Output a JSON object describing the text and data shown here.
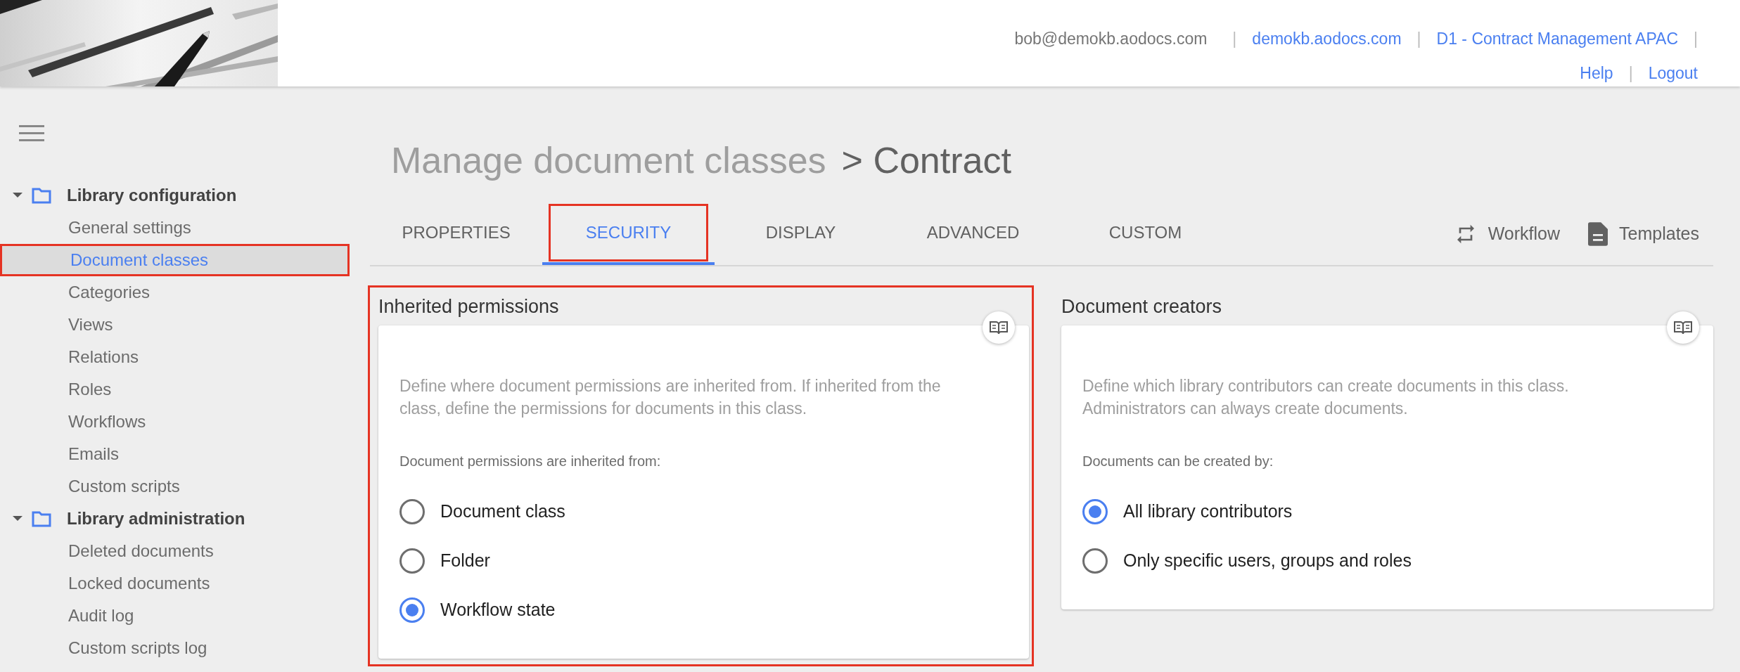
{
  "header": {
    "banner": {
      "kind": "picture"
    },
    "user_email": "bob@demokb.aodocs.com",
    "links": [
      {
        "label": "demokb.aodocs.com"
      },
      {
        "label": "D1 - Contract Management APAC"
      },
      {
        "label": "Help"
      },
      {
        "label": "Logout"
      }
    ],
    "separators": [
      "|",
      "|",
      "|",
      "|"
    ]
  },
  "sidebar": {
    "groups": [
      {
        "label": "Library configuration",
        "expanded": true,
        "children": [
          {
            "label": "General settings",
            "selected": false,
            "highlighted": false
          },
          {
            "label": "Document classes",
            "selected": true,
            "highlighted": true
          },
          {
            "label": "Categories",
            "selected": false,
            "highlighted": false
          },
          {
            "label": "Views",
            "selected": false,
            "highlighted": false
          },
          {
            "label": "Relations",
            "selected": false,
            "highlighted": false
          },
          {
            "label": "Roles",
            "selected": false,
            "highlighted": false
          },
          {
            "label": "Workflows",
            "selected": false,
            "highlighted": false
          },
          {
            "label": "Emails",
            "selected": false,
            "highlighted": false
          },
          {
            "label": "Custom scripts",
            "selected": false,
            "highlighted": false
          }
        ]
      },
      {
        "label": "Library administration",
        "expanded": true,
        "children": [
          {
            "label": "Deleted documents",
            "selected": false,
            "highlighted": false
          },
          {
            "label": "Locked documents",
            "selected": false,
            "highlighted": false
          },
          {
            "label": "Audit log",
            "selected": false,
            "highlighted": false
          },
          {
            "label": "Custom scripts log",
            "selected": false,
            "highlighted": false
          }
        ]
      }
    ]
  },
  "page_title": {
    "parent": "Manage document classes",
    "current": "> Contract"
  },
  "tabs": [
    {
      "label": "PROPERTIES",
      "selected": false,
      "highlighted": false
    },
    {
      "label": "SECURITY",
      "selected": true,
      "highlighted": true
    },
    {
      "label": "DISPLAY",
      "selected": false,
      "highlighted": false
    },
    {
      "label": "ADVANCED",
      "selected": false,
      "highlighted": false
    },
    {
      "label": "CUSTOM",
      "selected": false,
      "highlighted": false
    }
  ],
  "actions": [
    {
      "kind": "workflow",
      "label": "Workflow"
    },
    {
      "kind": "templates",
      "label": "Templates"
    }
  ],
  "panels": [
    {
      "title": "Inherited permissions",
      "highlighted": true,
      "description": "Define where document permissions are inherited from. If inherited from the class, define the permissions for documents in this class.",
      "question": "Document permissions are inherited from:",
      "options": [
        {
          "label": "Document class",
          "selected": false
        },
        {
          "label": "Folder",
          "selected": false
        },
        {
          "label": "Workflow state",
          "selected": true
        }
      ]
    },
    {
      "title": "Document creators",
      "highlighted": false,
      "description": "Define which library contributors can create documents in this class. Administrators can always create documents.",
      "question": "Documents can be created by:",
      "options": [
        {
          "label": "All library contributors",
          "selected": true
        },
        {
          "label": "Only specific users, groups and roles",
          "selected": false
        }
      ]
    }
  ]
}
